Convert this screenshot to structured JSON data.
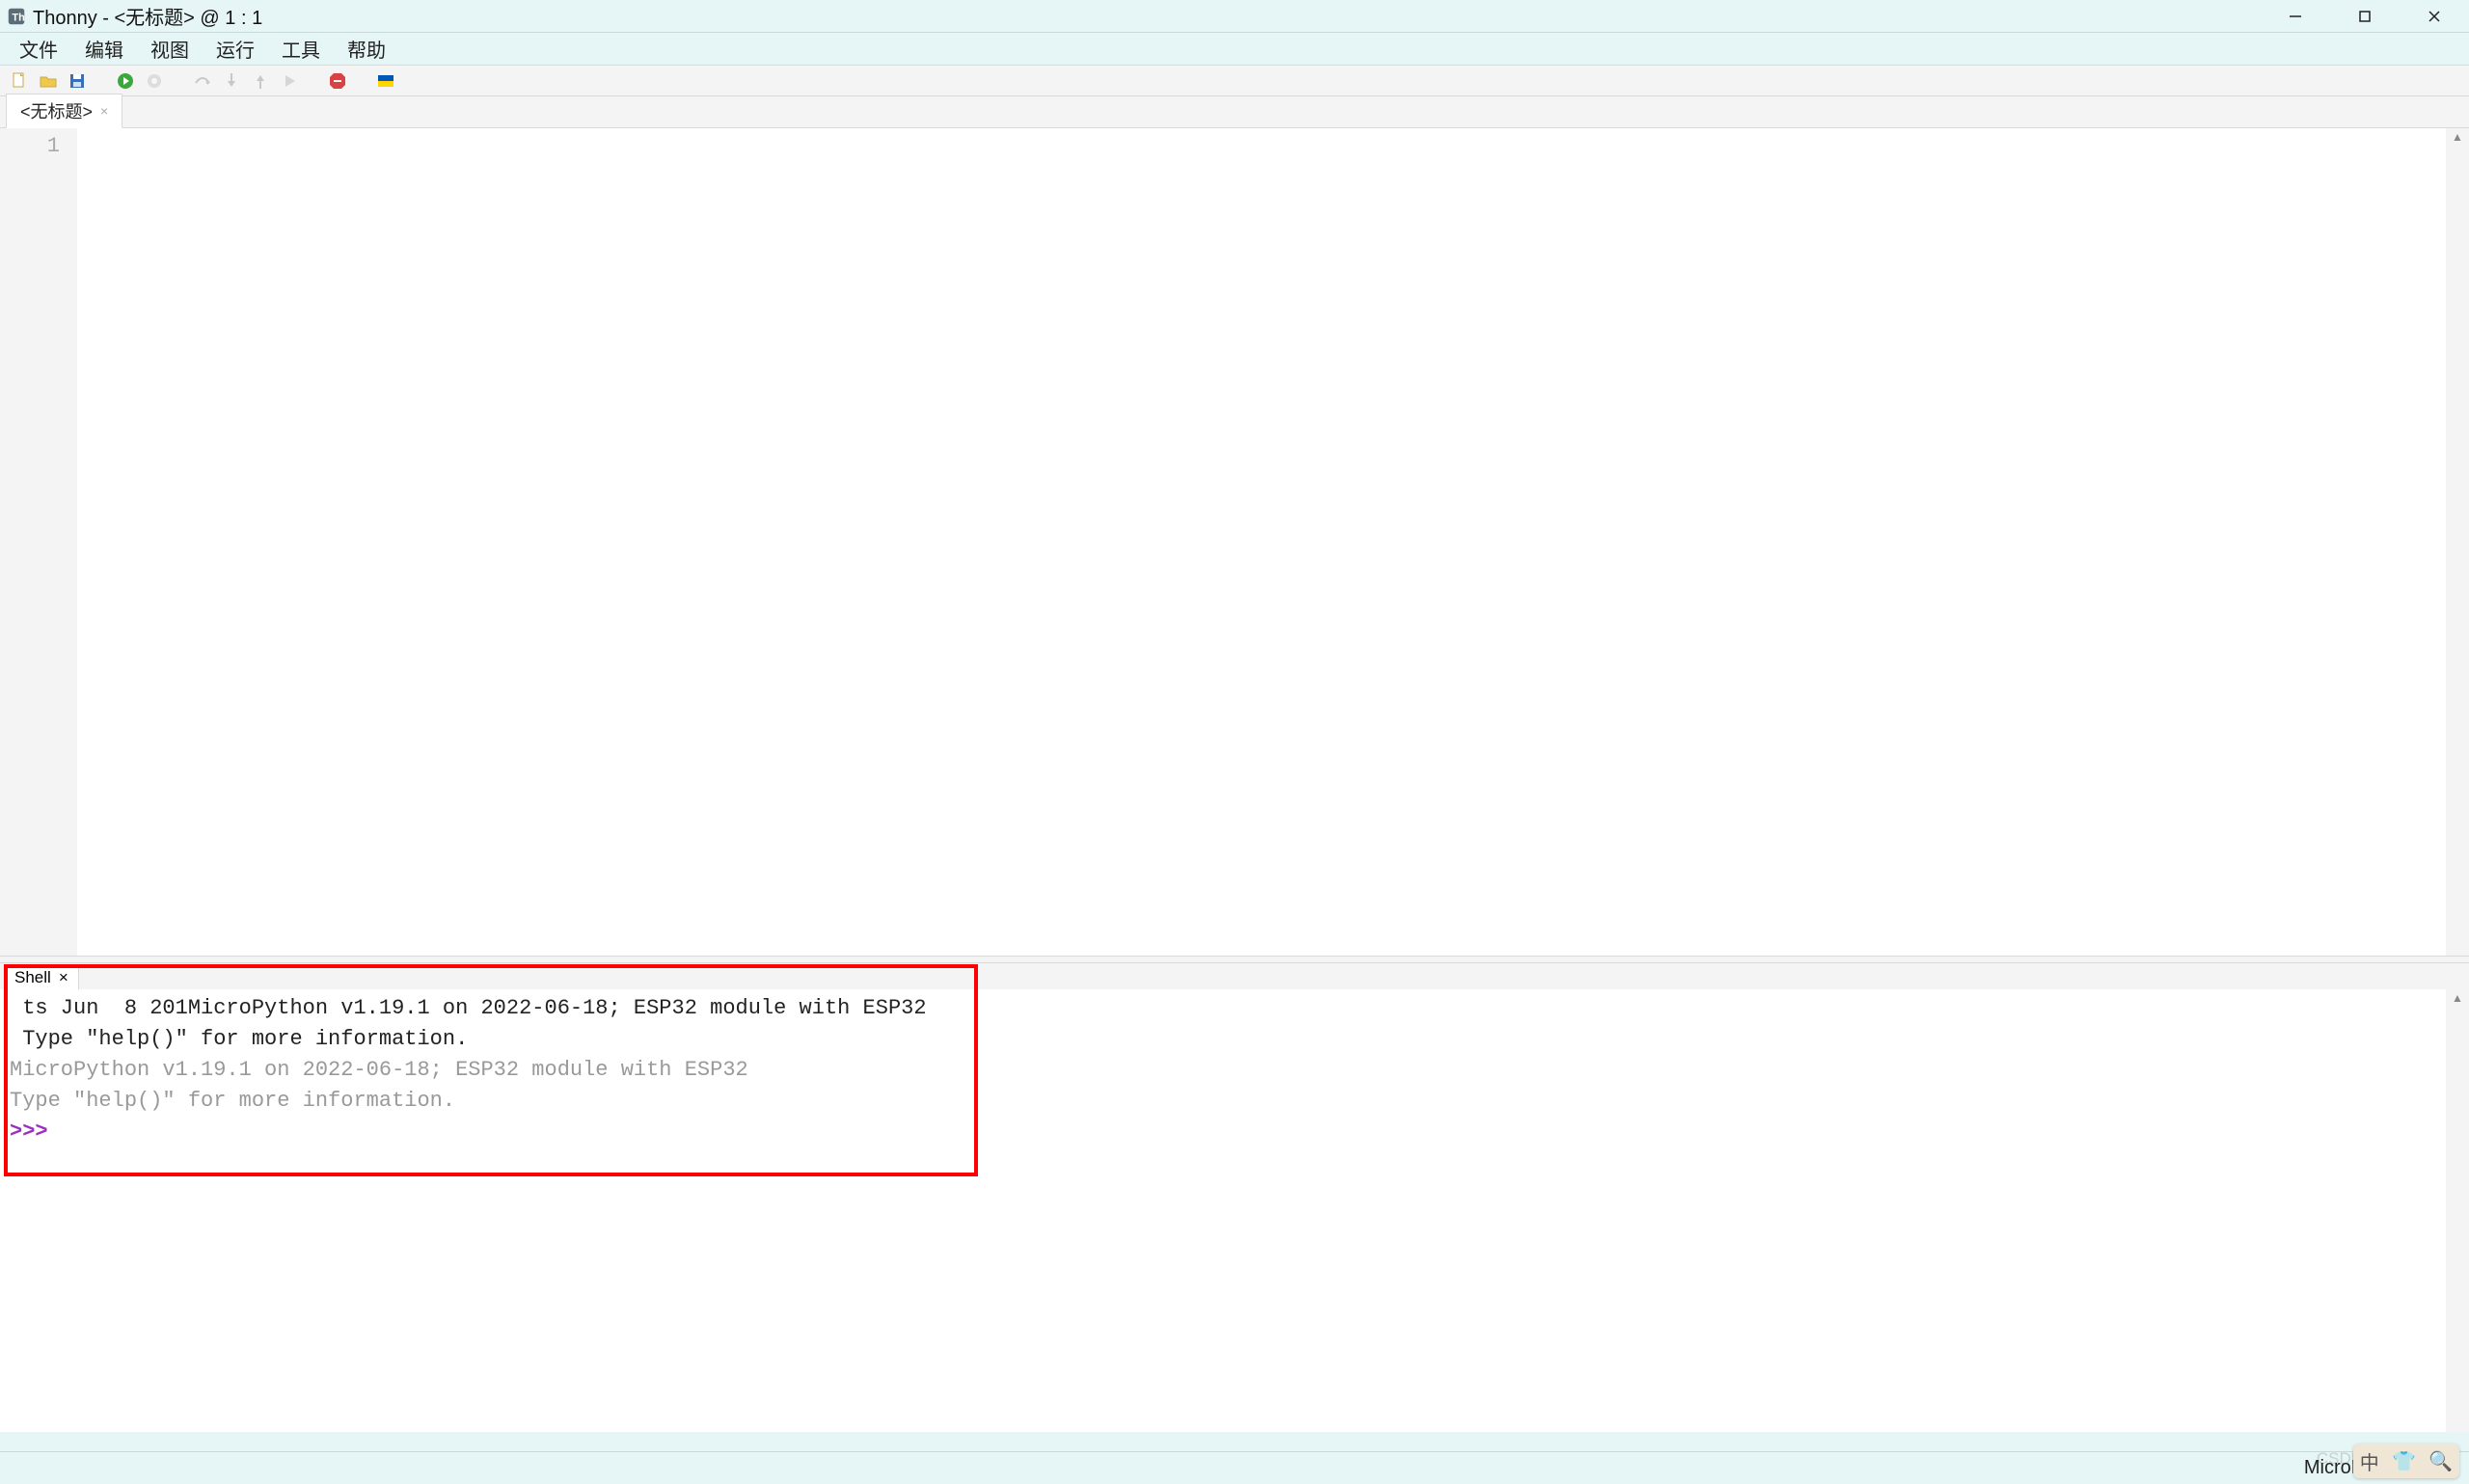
{
  "titlebar": {
    "app_name": "Thonny",
    "separator": " - ",
    "document": "<无标题>",
    "at": " @ ",
    "position": "1 : 1"
  },
  "menubar": {
    "items": [
      "文件",
      "编辑",
      "视图",
      "运行",
      "工具",
      "帮助"
    ]
  },
  "toolbar": {
    "icons": [
      "new-file-icon",
      "open-file-icon",
      "save-file-icon",
      "run-icon",
      "debug-icon",
      "step-over-icon",
      "step-into-icon",
      "step-out-icon",
      "resume-icon",
      "stop-icon",
      "ukraine-flag-icon"
    ]
  },
  "editor": {
    "tab_label": "<无标题>",
    "line_numbers": [
      "1"
    ]
  },
  "shell": {
    "tab_label": "Shell",
    "line1": " ts Jun  8 201MicroPython v1.19.1 on 2022-06-18; ESP32 module with ESP32",
    "line2": " Type \"help()\" for more information.",
    "line3_dim": "MicroPython v1.19.1 on 2022-06-18; ESP32 module with ESP32",
    "line4_dim": "Type \"help()\" for more information.",
    "prompt": ">>> "
  },
  "statusbar": {
    "interpreter": "MicroPython"
  },
  "ime": {
    "label": "中"
  },
  "watermark": "CSDN @古鱼夜游"
}
